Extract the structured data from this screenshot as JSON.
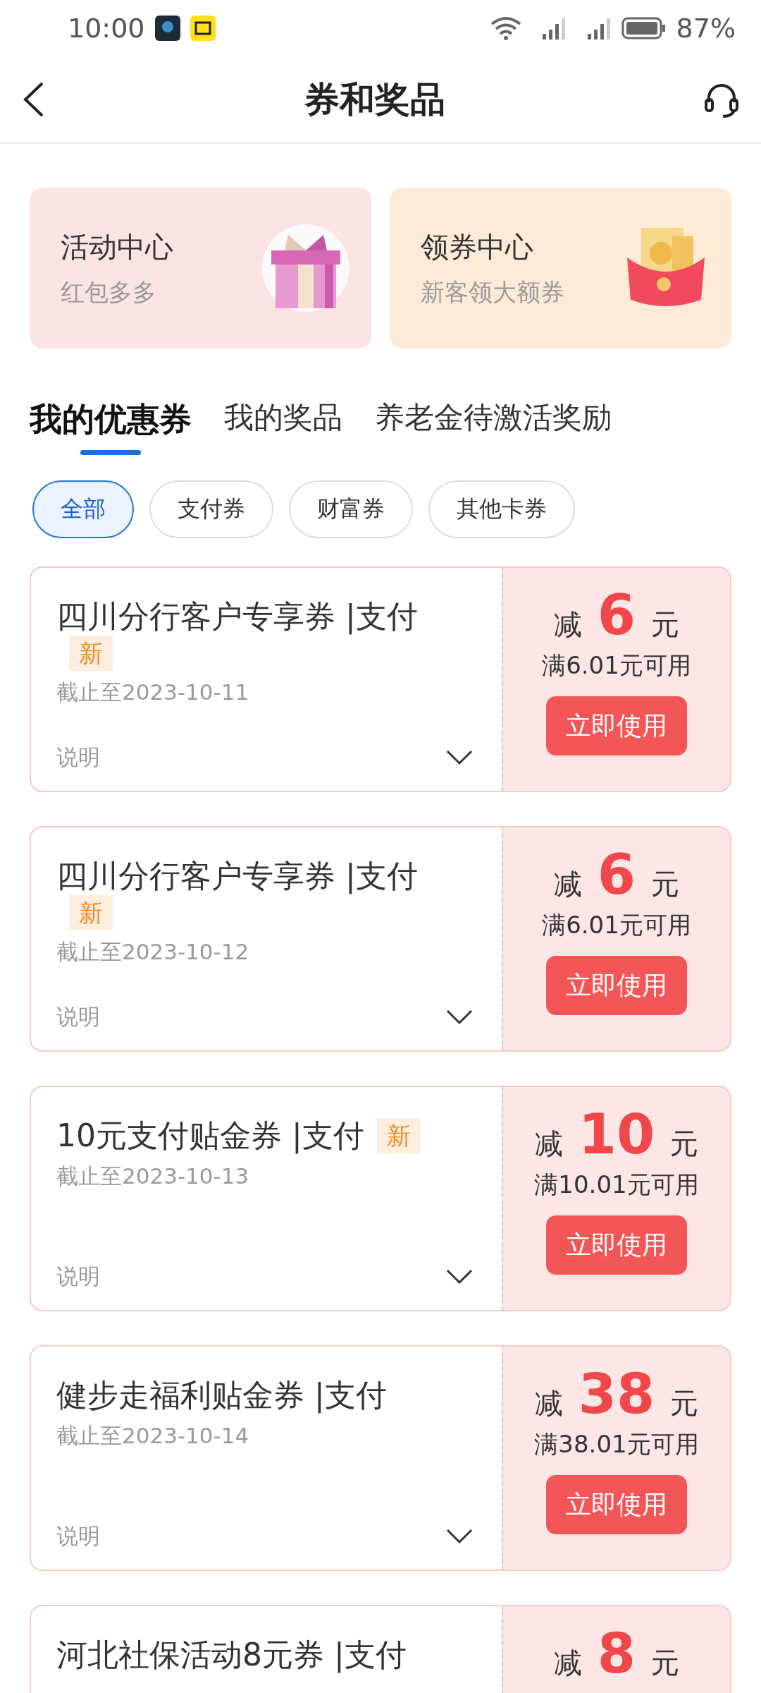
{
  "status_bar": {
    "time": "10:00",
    "battery": "87%"
  },
  "header": {
    "title": "券和奖品"
  },
  "entry_cards": [
    {
      "title": "活动中心",
      "subtitle": "红包多多",
      "color": "#fde4e4"
    },
    {
      "title": "领券中心",
      "subtitle": "新客领大额券",
      "color": "#fdebd7"
    }
  ],
  "tabs": [
    {
      "label": "我的优惠券",
      "selected": true
    },
    {
      "label": "我的奖品",
      "selected": false
    },
    {
      "label": "养老金待激活奖励",
      "selected": false
    }
  ],
  "filters": [
    {
      "label": "全部",
      "selected": true
    },
    {
      "label": "支付券",
      "selected": false
    },
    {
      "label": "财富券",
      "selected": false
    },
    {
      "label": "其他卡券",
      "selected": false
    }
  ],
  "coupons": [
    {
      "title": "四川分行客户专享券 |支付",
      "badge": "新",
      "expiry": "截止至2023-10-11",
      "note": "说明",
      "prefix": "减",
      "amount": "6",
      "unit": "元",
      "condition": "满6.01元可用",
      "button": "立即使用"
    },
    {
      "title": "四川分行客户专享券 |支付",
      "badge": "新",
      "expiry": "截止至2023-10-12",
      "note": "说明",
      "prefix": "减",
      "amount": "6",
      "unit": "元",
      "condition": "满6.01元可用",
      "button": "立即使用"
    },
    {
      "title": "10元支付贴金券 |支付",
      "badge": "新",
      "expiry": "截止至2023-10-13",
      "note": "说明",
      "prefix": "减",
      "amount": "10",
      "unit": "元",
      "condition": "满10.01元可用",
      "button": "立即使用"
    },
    {
      "title": "健步走福利贴金券 |支付",
      "expiry": "截止至2023-10-14",
      "note": "说明",
      "prefix": "减",
      "amount": "38",
      "unit": "元",
      "condition": "满38.01元可用",
      "button": "立即使用"
    },
    {
      "title": "河北社保活动8元券 |支付",
      "prefix": "减",
      "amount": "8",
      "unit": "元"
    }
  ]
}
